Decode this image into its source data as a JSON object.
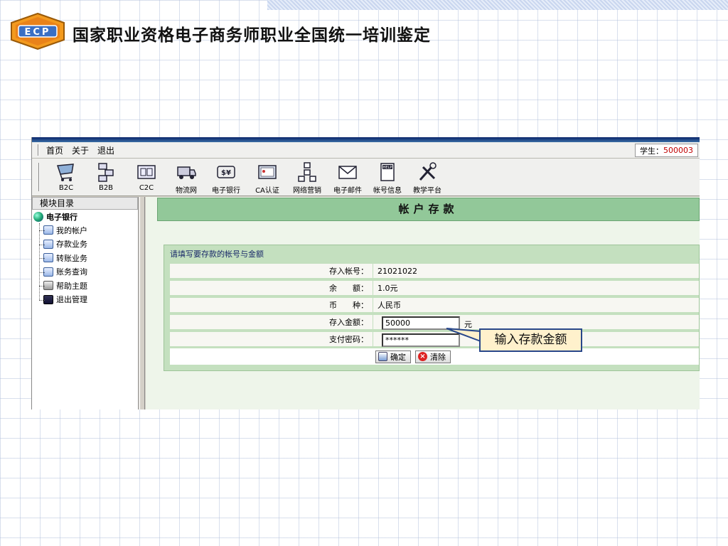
{
  "slide": {
    "title": "国家职业资格电子商务师职业全国统一培训鉴定",
    "logo_text": "ECP"
  },
  "menubar": {
    "items": [
      "首页",
      "关于",
      "退出"
    ],
    "student_label": "学生：",
    "student_id": "500003"
  },
  "toolbar": {
    "items": [
      {
        "label": "B2C",
        "icon": "shopping-cart-icon"
      },
      {
        "label": "B2B",
        "icon": "network-icon"
      },
      {
        "label": "C2C",
        "icon": "users-icon"
      },
      {
        "label": "物流网",
        "icon": "truck-icon"
      },
      {
        "label": "电子银行",
        "icon": "money-icon"
      },
      {
        "label": "CA认证",
        "icon": "certificate-icon"
      },
      {
        "label": "网络营销",
        "icon": "hierarchy-icon"
      },
      {
        "label": "电子邮件",
        "icon": "mail-icon"
      },
      {
        "label": "帐号信息",
        "icon": "help-book-icon"
      },
      {
        "label": "教学平台",
        "icon": "tools-icon"
      }
    ]
  },
  "sidebar": {
    "header": "模块目录",
    "root": "电子银行",
    "items": [
      "我的帐户",
      "存款业务",
      "转账业务",
      "账务查询",
      "帮助主题",
      "退出管理"
    ]
  },
  "main": {
    "title": "帐户存款",
    "form_title": "请填写要存款的帐号与金额",
    "rows": {
      "account_label": "存入帐号：",
      "account_value": "21021022",
      "balance_label": "余　　额：",
      "balance_value": "1.0元",
      "currency_label": "币　　种：",
      "currency_value": "人民币",
      "amount_label": "存入金额：",
      "amount_value": "50000",
      "amount_unit": "元",
      "password_label": "支付密码：",
      "password_value": "******"
    },
    "confirm_button": "确定",
    "clear_button": "清除"
  },
  "callout": {
    "text": "输入存款金额"
  },
  "colors": {
    "header_green": "#92c899",
    "form_green": "#c4e0bf",
    "callout_fill": "#fff1cc",
    "callout_border": "#28478a",
    "student_id": "#c00000"
  }
}
